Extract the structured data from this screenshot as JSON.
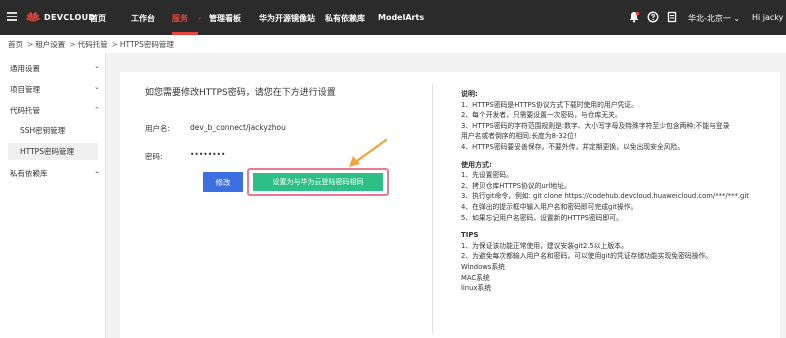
{
  "topbar": {
    "brand": "DEVCLOUD",
    "nav": [
      "首页",
      "工作台",
      "服务",
      "管理看板",
      "华为开源镜像站",
      "私有依赖库",
      "ModelArts"
    ],
    "active_nav": "服务",
    "caret": "⌄",
    "region": "华北-北京一 ⌄",
    "user": "Hi jacky",
    "icons": [
      "menu-icon",
      "huawei-logo-icon",
      "bell-icon",
      "help-icon",
      "document-icon"
    ],
    "bg_color": "#2b2b2b",
    "accent_color": "#e8453c"
  },
  "breadcrumb": [
    "首页",
    "租户设置",
    "代码托管",
    "HTTPS密码管理"
  ],
  "breadcrumb_sep": ">",
  "sidebar": {
    "groups": [
      {
        "label": "通用设置",
        "arrow": "⌄"
      },
      {
        "label": "项目管理",
        "arrow": "⌄"
      },
      {
        "label": "代码托管",
        "arrow": "⌃"
      },
      {
        "label": "私有依赖库",
        "arrow": "⌄"
      }
    ],
    "sub_items": [
      "SSH密钥管理",
      "HTTPS密码管理"
    ],
    "active_sub": "HTTPS密码管理"
  },
  "form": {
    "title": "如您需要修改HTTPS密码，请您在下方进行设置",
    "username_label": "用户名:",
    "username_value": "dev_b_connect/jackyzhou",
    "password_label": "密码:",
    "password_value": "••••••••",
    "modify_button": "修改",
    "set_button": "设置为与华为云登陆密码相同",
    "modify_color": "#3d6fe0",
    "set_color": "#2dbf86",
    "highlight_color": "#e87c8e",
    "arrow_color": "#f0a53c"
  },
  "help": {
    "notes_title": "说明:",
    "notes": [
      "1、HTTPS密码是HTTPS协议方式下载时使用的用户凭证。",
      "2、每个开发者，只需要设置一次密码，与仓库无关。",
      "3、HTTPS密码的字符范围规则是:数字、大小写字母及特殊字符至少包含两种;不能与登录",
      "用户名或者倒序的相同;长度为8-32位!",
      "4、HTTPS密码要妥善保存，不要外传，并定期更换，以免出现安全风险。"
    ],
    "usage_title": "使用方式:",
    "usage": [
      "1、先设置密码。",
      "2、拷贝仓库HTTPS协议的url地址。",
      "3、执行git命令，例如: git clone https://codehub.devcloud.huaweicloud.com/***/***.git",
      "4、在弹出的提示框中输入用户名和密码即可完成git操作。",
      "5、如果忘记用户名密码，设置新的HTTPS密码即可。"
    ],
    "tips_title": "TIPS",
    "tips": [
      "1、为保证该功能正常使用，建议安装git2.5以上版本。",
      "2、为避免每次都输入用户名和密码，可以使用git的凭证存储功能实现免密码操作。",
      "Windows系统",
      "MAC系统",
      "linux系统"
    ]
  }
}
